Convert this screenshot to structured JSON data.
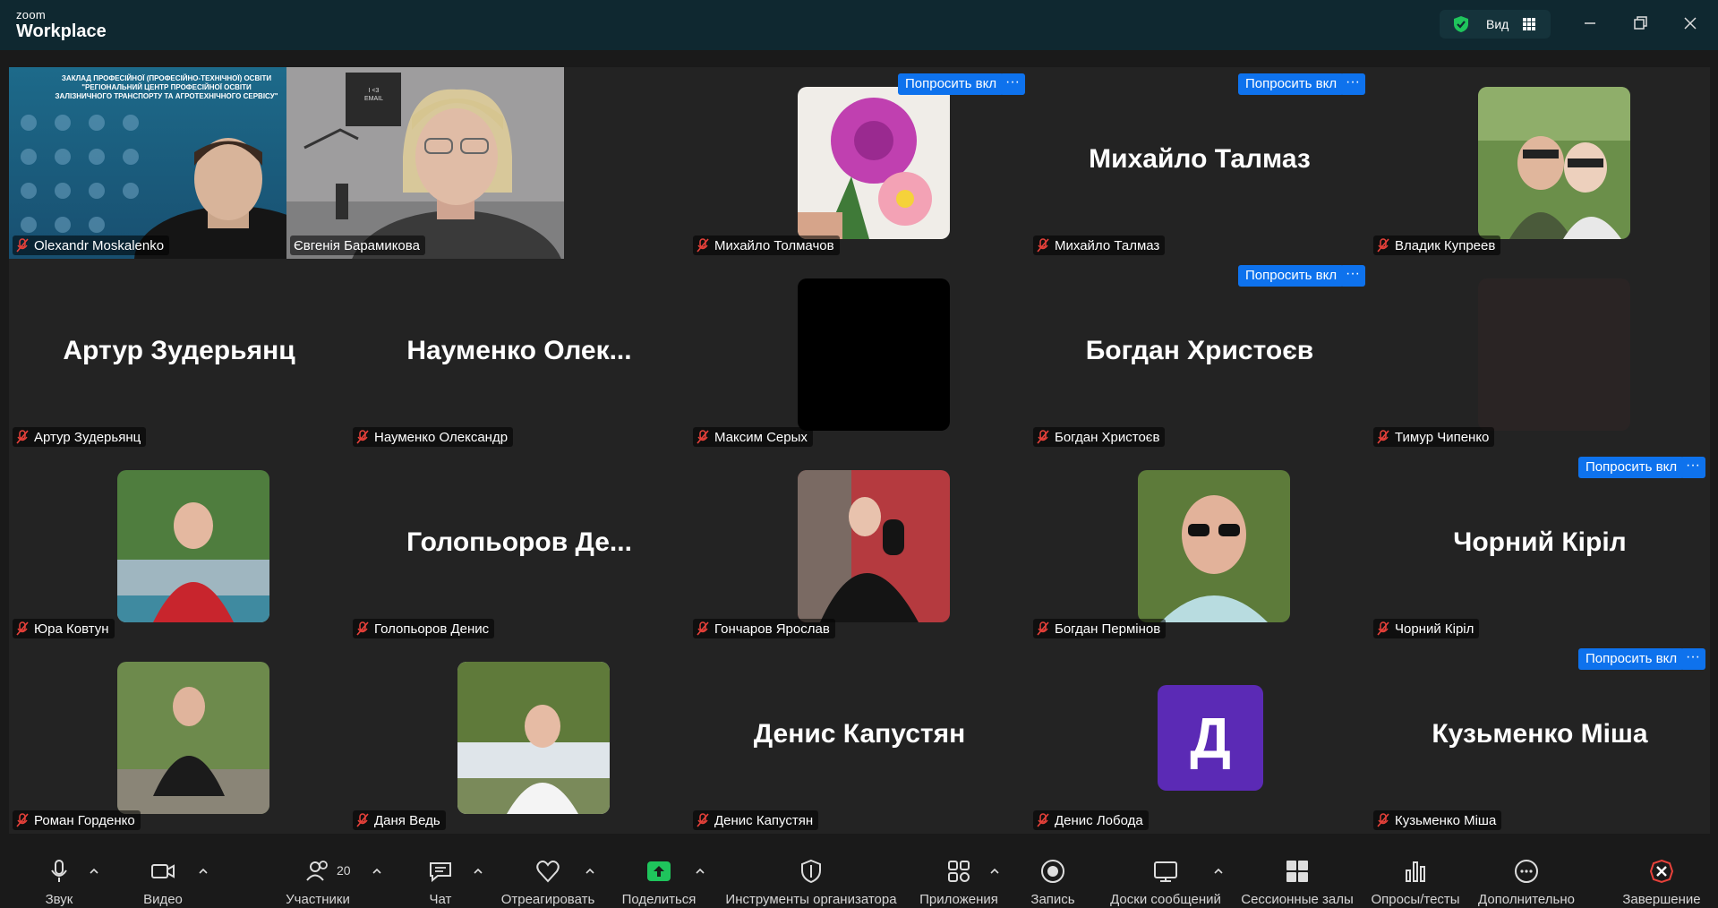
{
  "app": {
    "brand_small": "zoom",
    "brand_large": "Workplace"
  },
  "titlebar": {
    "view_label": "Вид"
  },
  "colors": {
    "accent_blue": "#0e72ed",
    "active_speaker": "#2bd67b",
    "mute_red": "#e8413a",
    "end_red": "#e8413a",
    "share_green": "#1fc45c"
  },
  "ask_label": "Попросить вкл",
  "more_label": "···",
  "tiles": [
    {
      "name": "Olexandr Moskalenko",
      "kind": "video",
      "banner": [
        "ЗАКЛАД ПРОФЕСІЙНОЇ (ПРОФЕСІЙНО-ТЕХНІЧНОЇ) ОСВІТИ",
        "\"РЕГІОНАЛЬНИЙ ЦЕНТР ПРОФЕСІЙНОЇ ОСВІТИ",
        "ЗАЛІЗНИЧНОГО ТРАНСПОРТУ ТА АГРОТЕХНІЧНОГО СЕРВІСУ\""
      ]
    },
    {
      "name": "Євгенія Барамикова",
      "kind": "video",
      "active": true,
      "board_text": [
        "I <3",
        "EMAIL"
      ]
    },
    {
      "name": "Михайло Толмачов",
      "kind": "photo",
      "icon": "flower-photo",
      "ask": true
    },
    {
      "name": "Михайло Талмаз",
      "kind": "text",
      "display": "Михайло Талмаз",
      "ask": true
    },
    {
      "name": "Владик Купреев",
      "kind": "photo",
      "icon": "couple-photo"
    },
    {
      "name": "Артур Зудерьянц",
      "kind": "text",
      "display": "Артур Зудерьянц"
    },
    {
      "name": "Науменко Олександр",
      "kind": "text",
      "display": "Науменко  Олек..."
    },
    {
      "name": "Максим Серых",
      "kind": "photo",
      "icon": "black-photo"
    },
    {
      "name": "Богдан Христоєв",
      "kind": "text",
      "display": "Богдан Христоєв",
      "ask": true
    },
    {
      "name": "Тимур Чипенко",
      "kind": "photo",
      "icon": "dark-photo"
    },
    {
      "name": "Юра Ковтун",
      "kind": "photo",
      "icon": "red-shirt-photo"
    },
    {
      "name": "Голопьоров Денис",
      "kind": "text",
      "display": "Голопьоров  Де..."
    },
    {
      "name": "Гончаров Ярослав",
      "kind": "photo",
      "icon": "hoodie-photo"
    },
    {
      "name": "Богдан Пермінов",
      "kind": "photo",
      "icon": "sunglasses-photo"
    },
    {
      "name": "Чорний Кіріл",
      "kind": "text",
      "display": "Чорний Кіріл",
      "ask": true
    },
    {
      "name": "Роман Горденко",
      "kind": "photo",
      "icon": "sitting-photo"
    },
    {
      "name": "Даня Ведь",
      "kind": "photo",
      "icon": "park-photo"
    },
    {
      "name": "Денис Капустян",
      "kind": "text",
      "display": "Денис Капустян"
    },
    {
      "name": "Денис Лобода",
      "kind": "letter",
      "letter": "Д",
      "avatar_color": "#5b2ab5"
    },
    {
      "name": "Кузьменко Міша",
      "kind": "text",
      "display": "Кузьменко Міша",
      "ask": true
    }
  ],
  "toolbar": {
    "audio": "Звук",
    "video": "Видео",
    "participants": "Участники",
    "participants_count": "20",
    "chat": "Чат",
    "react": "Отреагировать",
    "share": "Поделиться",
    "host_tools": "Инструменты организатора",
    "apps": "Приложения",
    "record": "Запись",
    "whiteboards": "Доски сообщений",
    "breakout": "Сессионные залы",
    "polls": "Опросы/тесты",
    "more": "Дополнительно",
    "end": "Завершение"
  }
}
